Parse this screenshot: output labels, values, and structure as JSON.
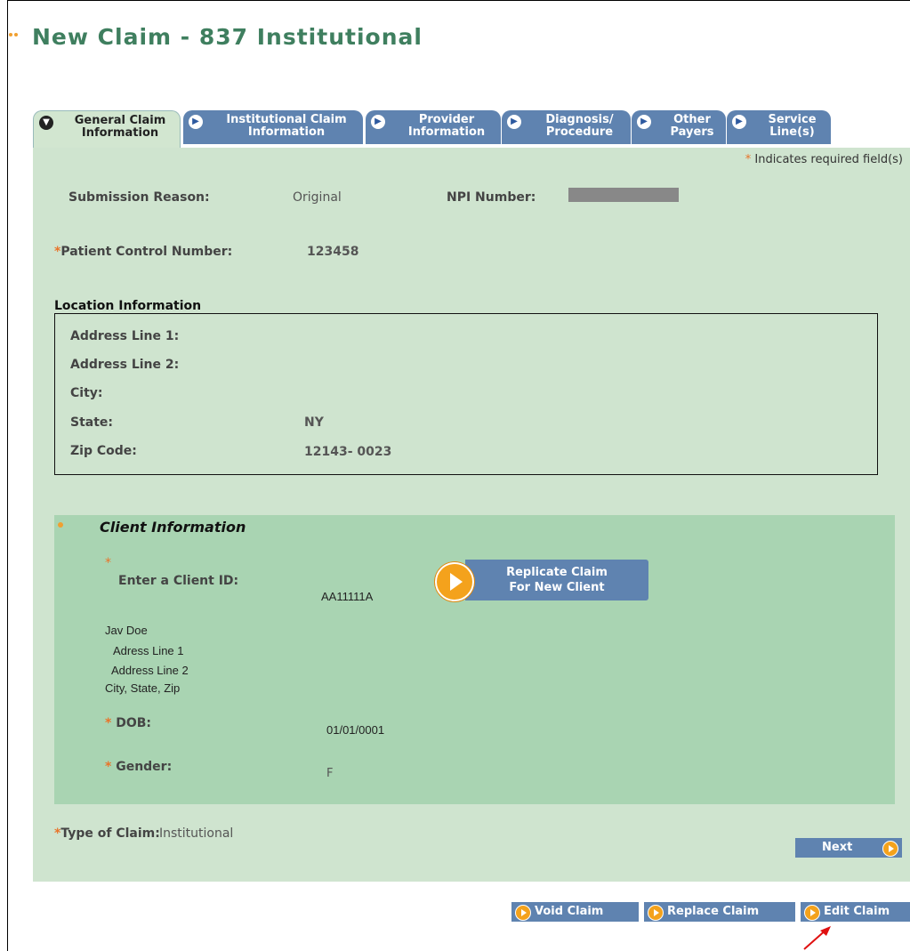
{
  "title": "New Claim - 837 Institutional",
  "tabs": [
    {
      "label": "General Claim\nInformation",
      "active": true
    },
    {
      "label": "Institutional Claim\nInformation",
      "active": false
    },
    {
      "label": "Provider\nInformation",
      "active": false
    },
    {
      "label": "Diagnosis/\nProcedure",
      "active": false
    },
    {
      "label": "Other\nPayers",
      "active": false
    },
    {
      "label": "Service\nLine(s)",
      "active": false
    }
  ],
  "required_note": "Indicates required field(s)",
  "submission_reason": {
    "label": "Submission Reason:",
    "value": "Original"
  },
  "npi": {
    "label": "NPI Number:"
  },
  "patient_control": {
    "label": "Patient Control Number:",
    "value": "123458"
  },
  "location": {
    "title": "Location Information",
    "address1_label": "Address Line 1:",
    "address2_label": "Address Line 2:",
    "city_label": "City:",
    "state_label": "State:",
    "state_value": "NY",
    "zip_label": "Zip Code:",
    "zip_value": "12143- 0023"
  },
  "client": {
    "title": "Client Information",
    "id_label": "Enter a Client ID:",
    "id_value": "AA11111A",
    "replicate_label_1": "Replicate Claim",
    "replicate_label_2": "For New Client",
    "name": "Jav Doe",
    "addr1": "Adress Line 1",
    "addr2": "Address Line 2",
    "city_state_zip": "City, State, Zip",
    "dob_label": "DOB:",
    "dob_value": "01/01/0001",
    "gender_label": "Gender:",
    "gender_value": "F"
  },
  "type_of_claim": {
    "label": "Type of Claim:",
    "value": "Institutional"
  },
  "buttons": {
    "next": "Next",
    "void": "Void Claim",
    "replace": "Replace Claim",
    "edit": "Edit Claim"
  },
  "colors": {
    "title": "#3f7f5f",
    "tab": "#5f83b0",
    "panel": "#cfe4cf",
    "client_panel": "#a9d4b2",
    "accent": "#f4a21c",
    "required": "#e8742a"
  }
}
